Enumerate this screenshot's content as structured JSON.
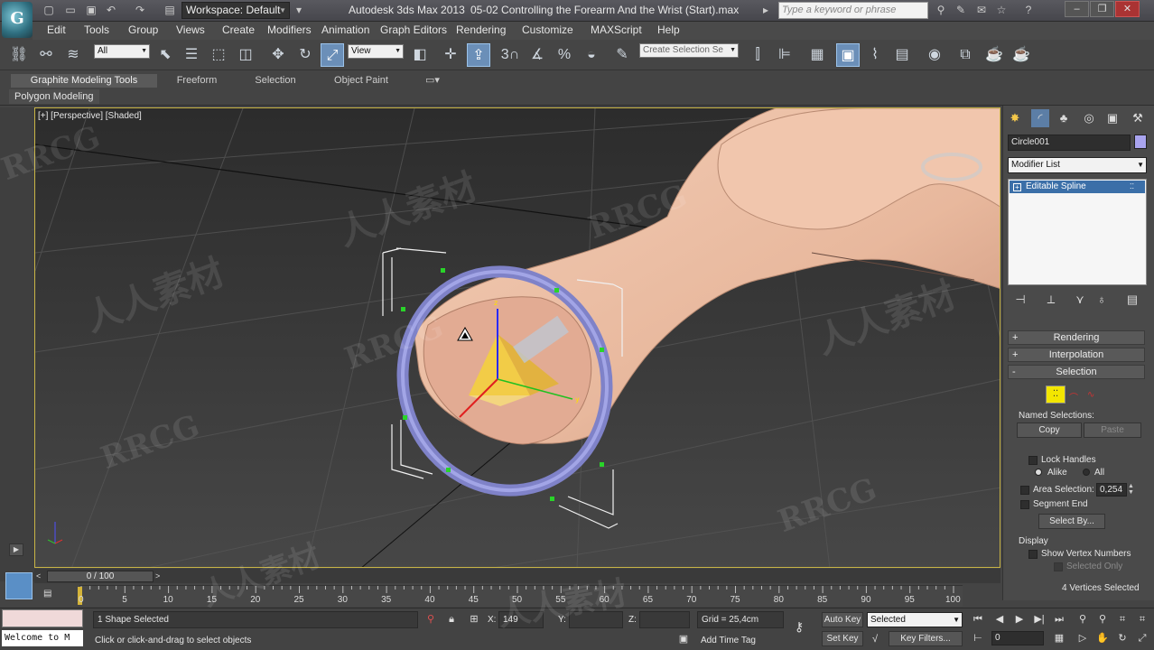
{
  "titlebar": {
    "app_logo": "G",
    "workspace": "Workspace: Default",
    "title": "Autodesk 3ds Max  2013",
    "filename": "05-02 Controlling the Forearm And the Wrist (Start).max",
    "search_placeholder": "Type a keyword or phrase"
  },
  "menu": [
    "Edit",
    "Tools",
    "Group",
    "Views",
    "Create",
    "Modifiers",
    "Animation",
    "Graph Editors",
    "Rendering",
    "Customize",
    "MAXScript",
    "Help"
  ],
  "toolbar": {
    "selection_filter": "All",
    "reference_coord": "View",
    "snap_label": "3",
    "named_selection_placeholder": "Create Selection Se"
  },
  "ribbon": {
    "tabs": [
      "Graphite Modeling Tools",
      "Freeform",
      "Selection",
      "Object Paint"
    ],
    "sub": "Polygon Modeling"
  },
  "viewport": {
    "label": "[+] [Perspective] [Shaded]"
  },
  "command_panel": {
    "object_name": "Circle001",
    "object_color": "#a9a4ef",
    "modifier_list": "Modifier List",
    "stack_item": "Editable Spline",
    "rollouts": {
      "rendering": "Rendering",
      "interpolation": "Interpolation",
      "selection": "Selection"
    },
    "named_selections_label": "Named Selections:",
    "copy": "Copy",
    "paste": "Paste",
    "lock_handles": "Lock Handles",
    "alike": "Alike",
    "all": "All",
    "area_selection": "Area Selection:",
    "area_value": "0,254",
    "segment_end": "Segment End",
    "select_by": "Select By...",
    "display_label": "Display",
    "show_vertex_numbers": "Show Vertex Numbers",
    "selected_only": "Selected Only",
    "vertices_selected": "4 Vertices Selected"
  },
  "timeline": {
    "slider": "0 / 100",
    "ticks": [
      "0",
      "5",
      "10",
      "15",
      "20",
      "25",
      "30",
      "35",
      "40",
      "45",
      "50",
      "55",
      "60",
      "65",
      "70",
      "75",
      "80",
      "85",
      "90",
      "95",
      "100"
    ]
  },
  "status": {
    "listener": "Welcome to M",
    "selection_count": "1 Shape Selected",
    "prompt": "Click or click-and-drag to select objects",
    "x_label": "X:",
    "x_value": "149",
    "y_label": "Y:",
    "z_label": "Z:",
    "grid": "Grid = 25,4cm",
    "add_time_tag": "Add Time Tag",
    "auto_key": "Auto Key",
    "set_key": "Set Key",
    "key_mode": "Selected",
    "key_filters": "Key Filters...",
    "frame": "0"
  },
  "watermarks": [
    "RRCG",
    "人人素材"
  ]
}
